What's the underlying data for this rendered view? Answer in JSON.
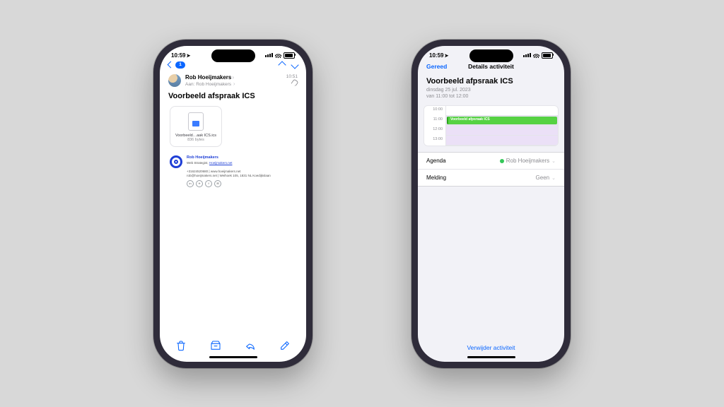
{
  "status": {
    "time": "10:59",
    "loc_glyph": "➤"
  },
  "mail": {
    "badge": "1",
    "sender_name": "Rob Hoeijmakers",
    "to_prefix": "Aan:",
    "to_name": "Rob Hoeijmakers",
    "time": "10:51",
    "subject": "Voorbeeld afspraak ICS",
    "attach_name": "Voorbeeld…aak ICS.ics",
    "attach_size": "836 bytes",
    "sig_name": "Rob Hoeijmakers",
    "sig_role": "Web Strategist,",
    "sig_domain": "Hoeijmakers.net",
    "sig_line1": "+31624520680  |  www.hoeijmakers.net",
    "sig_line2": "rob@hoeijmakers.net  |  Weihoek 105, 1831 NL Koedijkslaan",
    "soc": {
      "a": "in",
      "b": "✈",
      "c": "f",
      "d": "✉"
    }
  },
  "cal": {
    "done": "Gereed",
    "nav_title": "Details activiteit",
    "title": "Voorbeeld afpsraak ICS",
    "date": "dinsdag 25 jul. 2023",
    "time": "van 11:00 tot 12:00",
    "hours": {
      "h0": "10:00",
      "h1": "11:00",
      "h2": "12:00",
      "h3": "13:00"
    },
    "event_label": "Voorbeeld afpsraak ICS",
    "row_agenda": "Agenda",
    "row_agenda_val": "Rob Hoeijmakers",
    "row_alert": "Melding",
    "row_alert_val": "Geen",
    "delete": "Verwijder activiteit"
  }
}
